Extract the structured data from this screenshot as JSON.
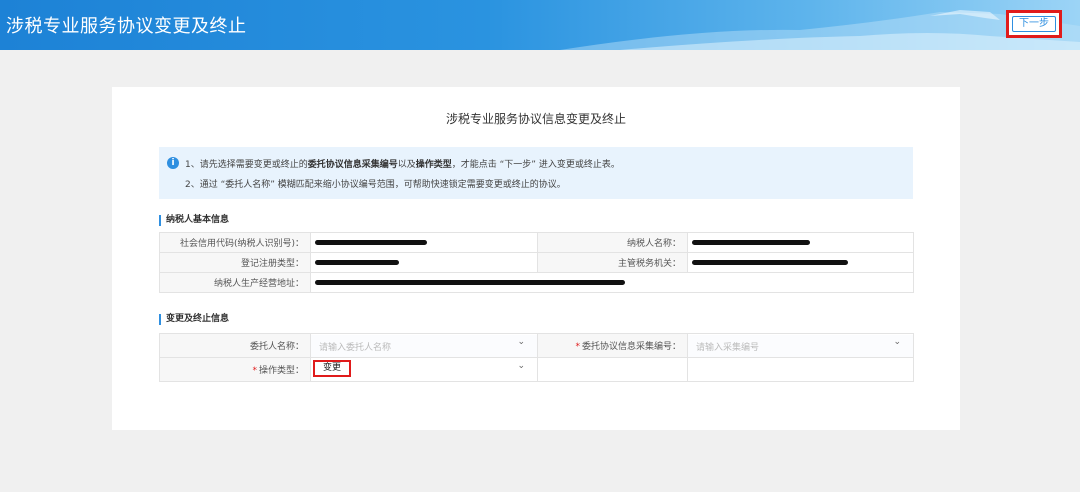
{
  "header": {
    "title": "涉税专业服务协议变更及终止",
    "next_button": "下一步"
  },
  "card": {
    "title": "涉税专业服务协议信息变更及终止",
    "notice": {
      "line1_a": "1、请先选择需要变更或终止的",
      "line1_b": "委托协议信息采集编号",
      "line1_c": "以及",
      "line1_d": "操作类型",
      "line1_e": "，才能点击 “下一步” 进入变更或终止表。",
      "line2": "2、通过 “委托人名称” 模糊匹配来缩小协议编号范围，可帮助快速锁定需要变更或终止的协议。"
    }
  },
  "taxpayer_section": {
    "title": "纳税人基本信息",
    "credit_code_label": "社会信用代码(纳税人识别号)：",
    "name_label": "纳税人名称：",
    "reg_type_label": "登记注册类型：",
    "tax_office_label": "主管税务机关：",
    "address_label": "纳税人生产经营地址："
  },
  "change_section": {
    "title": "变更及终止信息",
    "client_name_label": "委托人名称：",
    "client_name_placeholder": "请输入委托人名称",
    "agreement_no_label": "委托协议信息采集编号：",
    "agreement_no_placeholder": "请输入采集编号",
    "op_type_label": "操作类型：",
    "op_type_value": "变更"
  },
  "colors": {
    "accent": "#2f8fe0",
    "highlight": "#e01b1b",
    "redaction": "#111111"
  }
}
